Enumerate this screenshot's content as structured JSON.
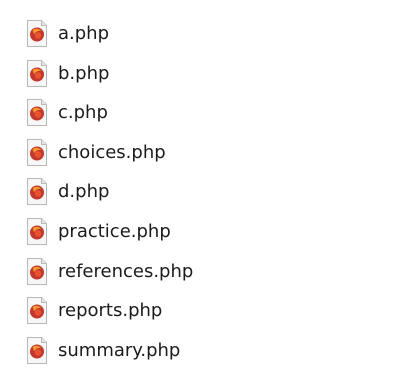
{
  "files": [
    {
      "name": "a.php",
      "icon": "php-file-icon"
    },
    {
      "name": "b.php",
      "icon": "php-file-icon"
    },
    {
      "name": "c.php",
      "icon": "php-file-icon"
    },
    {
      "name": "choices.php",
      "icon": "php-file-icon"
    },
    {
      "name": "d.php",
      "icon": "php-file-icon"
    },
    {
      "name": "practice.php",
      "icon": "php-file-icon"
    },
    {
      "name": "references.php",
      "icon": "php-file-icon"
    },
    {
      "name": "reports.php",
      "icon": "php-file-icon"
    },
    {
      "name": "summary.php",
      "icon": "php-file-icon"
    }
  ],
  "colors": {
    "icon_red": "#c3382d",
    "icon_orange": "#f49a2e",
    "icon_page": "#f7f7f7",
    "text": "#1b1b1b"
  }
}
